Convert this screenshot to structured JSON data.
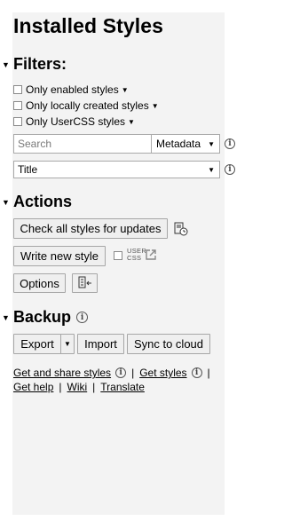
{
  "header": {
    "title": "Installed Styles"
  },
  "filters": {
    "heading": "Filters:",
    "options": [
      "Only enabled styles",
      "Only locally created styles",
      "Only UserCSS styles"
    ],
    "search_placeholder": "Search",
    "search_scope": "Metadata",
    "sort_value": "Title"
  },
  "actions": {
    "heading": "Actions",
    "check_updates": "Check all styles for updates",
    "write_new": "Write new style",
    "usercss_label": "USER\nCSS",
    "options": "Options"
  },
  "backup": {
    "heading": "Backup",
    "export": "Export",
    "import": "Import",
    "sync": "Sync to cloud"
  },
  "links": {
    "get_share": "Get and share styles",
    "get_styles": "Get styles",
    "get_help": "Get help",
    "wiki": "Wiki",
    "translate": "Translate",
    "separator": "|"
  }
}
